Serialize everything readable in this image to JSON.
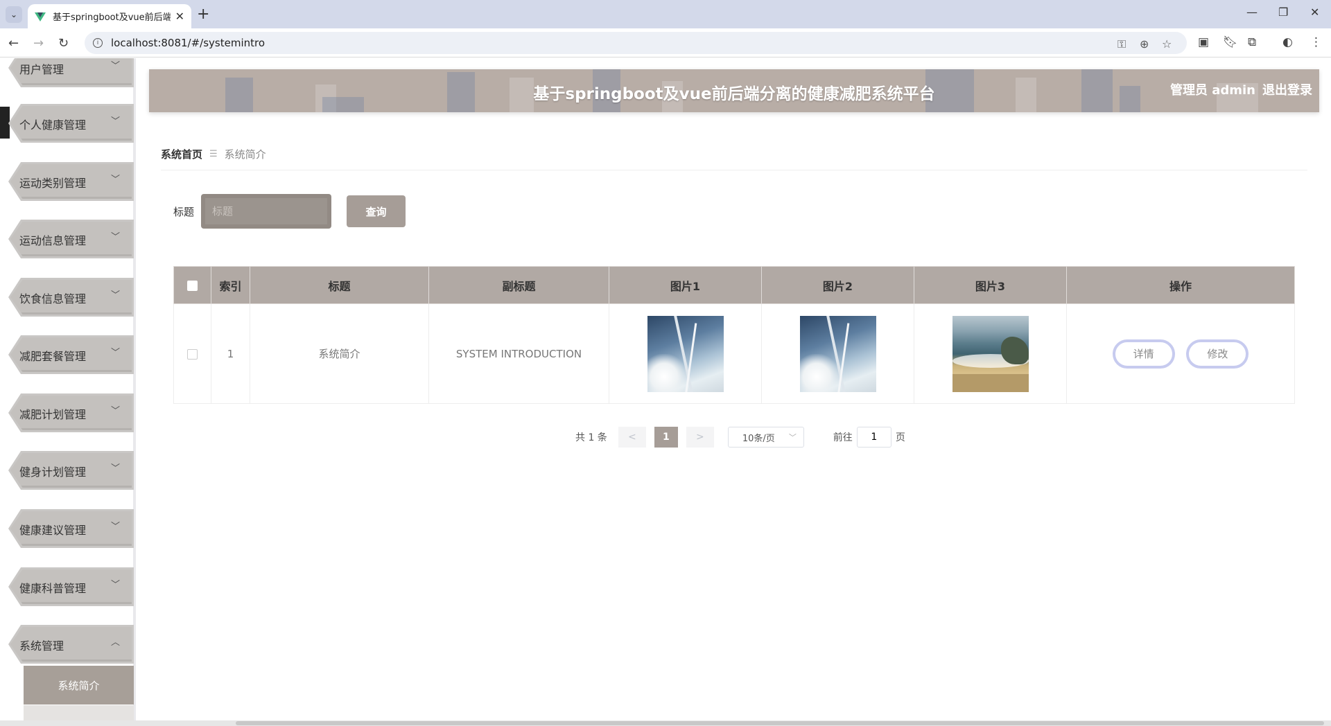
{
  "browser": {
    "tab_title": "基于springboot及vue前后端分",
    "url": "localhost:8081/#/systemintro"
  },
  "header": {
    "title": "基于springboot及vue前后端分离的健康减肥系统平台",
    "user": "管理员 admin",
    "logout": "退出登录"
  },
  "sidebar": {
    "items": [
      {
        "label": "用户管理"
      },
      {
        "label": "个人健康管理"
      },
      {
        "label": "运动类别管理"
      },
      {
        "label": "运动信息管理"
      },
      {
        "label": "饮食信息管理"
      },
      {
        "label": "减肥套餐管理"
      },
      {
        "label": "减肥计划管理"
      },
      {
        "label": "健身计划管理"
      },
      {
        "label": "健康建议管理"
      },
      {
        "label": "健康科普管理"
      },
      {
        "label": "系统管理"
      }
    ],
    "active_sub": "系统简介"
  },
  "breadcrumb": {
    "home": "系统首页",
    "current": "系统简介"
  },
  "search": {
    "label": "标题",
    "placeholder": "标题",
    "button": "查询"
  },
  "table": {
    "headers": [
      "索引",
      "标题",
      "副标题",
      "图片1",
      "图片2",
      "图片3",
      "操作"
    ],
    "rows": [
      {
        "index": "1",
        "title": "系统简介",
        "subtitle": "SYSTEM INTRODUCTION",
        "detail": "详情",
        "edit": "修改"
      }
    ]
  },
  "pager": {
    "total": "共 1 条",
    "prev": "<",
    "current": "1",
    "next": ">",
    "page_size": "10条/页",
    "goto_label": "前往",
    "goto_value": "1",
    "page_unit": "页"
  },
  "colors": {
    "accent": "#a69d97",
    "header_bg": "#b8ada6",
    "table_head": "#b1a9a4"
  }
}
